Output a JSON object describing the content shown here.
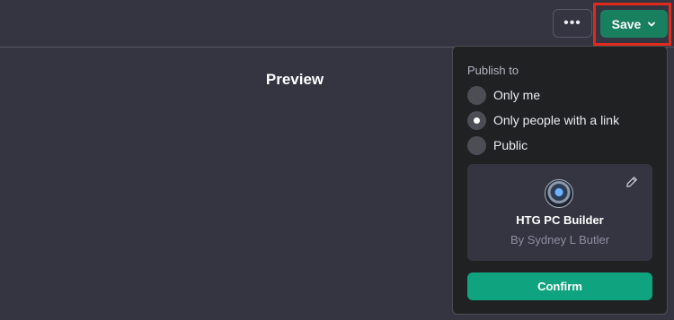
{
  "header": {
    "more_icon": "ellipsis-icon",
    "more_label": "•••",
    "save_label": "Save",
    "save_icon": "chevron-down-icon",
    "accent_green": "#19805f",
    "highlight_color": "#e02b1c"
  },
  "preview": {
    "title": "Preview"
  },
  "publish_menu": {
    "heading": "Publish to",
    "options": [
      {
        "label": "Only me",
        "selected": false
      },
      {
        "label": "Only people with a link",
        "selected": true
      },
      {
        "label": "Public",
        "selected": false
      }
    ],
    "card": {
      "name": "HTG PC Builder",
      "author": "By Sydney L Butler",
      "edit_icon": "pencil-icon"
    },
    "confirm_label": "Confirm",
    "confirm_color": "#10a37f"
  }
}
